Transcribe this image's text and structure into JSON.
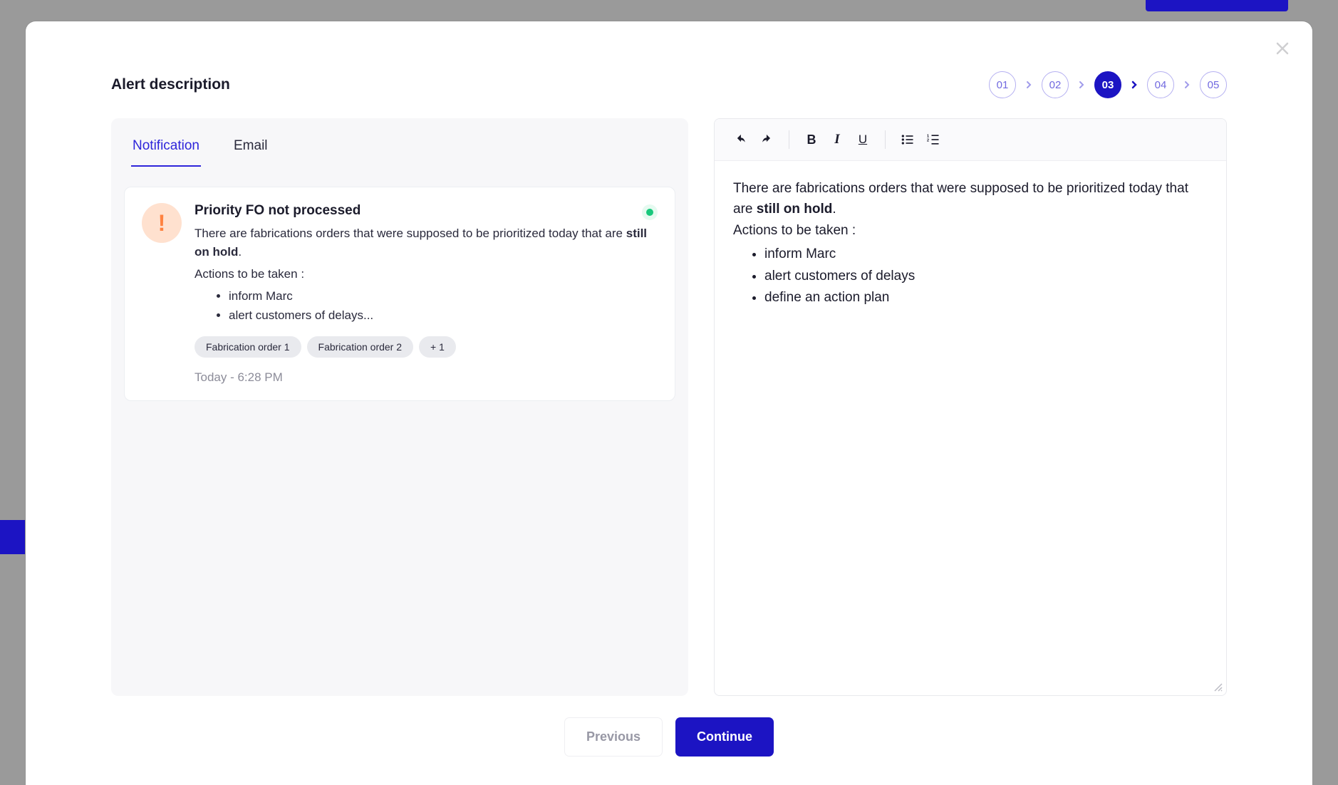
{
  "header": {
    "title": "Alert description"
  },
  "stepper": {
    "steps": [
      "01",
      "02",
      "03",
      "04",
      "05"
    ],
    "activeIndex": 2
  },
  "tabs": {
    "notification": "Notification",
    "email": "Email"
  },
  "preview": {
    "title": "Priority FO not processed",
    "intro_pre": "There are fabrications orders that were supposed to be prioritized today that are ",
    "intro_bold": "still on hold",
    "intro_post": ".",
    "actions_label": "Actions to be taken :",
    "actions": [
      "inform Marc",
      "alert customers of delays..."
    ],
    "tags": [
      "Fabrication order 1",
      "Fabrication order 2",
      "+ 1"
    ],
    "timestamp": "Today - 6:28 PM"
  },
  "editor": {
    "intro_pre": "There are fabrications orders that were supposed to be prioritized today that are ",
    "intro_bold": "still on hold",
    "intro_post": ".",
    "actions_label": "Actions to be taken :",
    "actions": [
      "inform Marc",
      "alert customers of delays",
      "define an action plan"
    ]
  },
  "toolbar": {
    "bold": "B",
    "italic": "I",
    "underline": "U"
  },
  "footer": {
    "previous": "Previous",
    "continue": "Continue"
  }
}
